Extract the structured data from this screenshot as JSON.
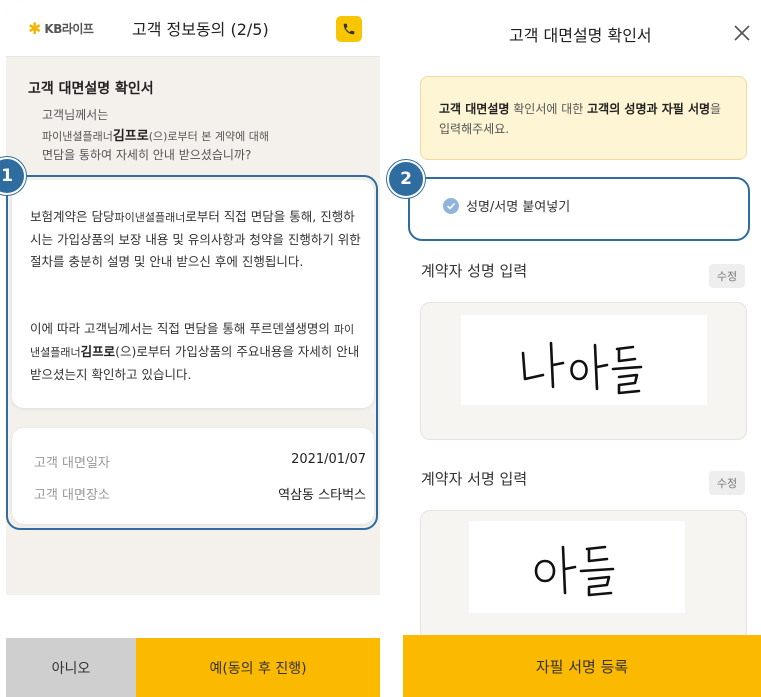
{
  "left": {
    "header": {
      "logo_text": "KB라이프",
      "title": "고객 정보동의 (2/5)"
    },
    "section_title": "고객 대면설명 확인서",
    "subtitle": {
      "line1": "고객님께서는",
      "line2_pre": "파이낸셜플래너",
      "line2_name": "김프로",
      "line2_post": "(으)로부터 본 계약에 대해",
      "line3": "면담을 통하여 자세히 안내 받으셨습니까?"
    },
    "body": {
      "para1_a": "보험계약은 담당",
      "para1_small": "파이낸셜플래너",
      "para1_b": "로부터 직접 면담을 통해, 진행하시는 가입상품의 보장 내용 및 유의사항과 청약을 진행하기 위한 절차를 충분히 설명 및 안내 받으신 후에 진행됩니다.",
      "para2_a": "이에 따라 고객님께서는 직접 면담을 통해 푸르덴셜생명의 ",
      "para2_small": "파이낸셜플래너",
      "para2_name": "김프로",
      "para2_b": "(으)로부터 가입상품의 주요내용을 자세히 안내받으셨는지 확인하고 있습니다."
    },
    "info": {
      "date_label": "고객 대면일자",
      "date_value": "2021/01/07",
      "place_label": "고객 대면장소",
      "place_value": "역삼동 스타벅스"
    },
    "buttons": {
      "no": "아니오",
      "yes": "예(동의 후 진행)"
    },
    "badge": "1"
  },
  "right": {
    "header": {
      "title": "고객 대면설명 확인서"
    },
    "notice": {
      "b1": "고객 대면설명",
      "t1": " 확인서에 대한 ",
      "b2": "고객의 성명과 자필 서명",
      "t2": "을 입력해주세요."
    },
    "paste_label": "성명/서명 붙여넣기",
    "name_field": {
      "label": "계약자 성명 입력",
      "edit": "수정",
      "signature": "나아들"
    },
    "sign_field": {
      "label": "계약자 서명 입력",
      "edit": "수정",
      "signature": "아들"
    },
    "register_button": "자필 서명 등록",
    "badge": "2"
  },
  "colors": {
    "accent": "#fbb900",
    "highlight": "#2f6ca0",
    "notice_bg": "#fdf5d3"
  }
}
